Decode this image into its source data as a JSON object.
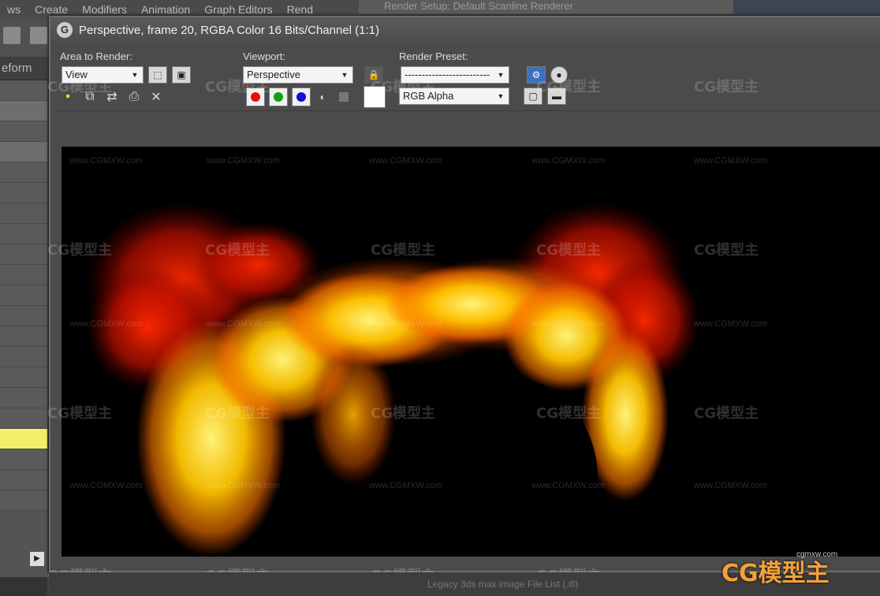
{
  "background": {
    "menu": [
      "ws",
      "Create",
      "Modifiers",
      "Animation",
      "Graph Editors",
      "Rend"
    ],
    "left_tab": "eform",
    "render_setup_title": "Render Setup: Default Scanline Renderer",
    "bottom_status": "Legacy 3ds max image File List (.ifl)"
  },
  "window": {
    "title": "Perspective, frame 20, RGBA Color 16 Bits/Channel (1:1)"
  },
  "controls": {
    "area_label": "Area to Render:",
    "area_value": "View",
    "viewport_label": "Viewport:",
    "viewport_value": "Perspective",
    "preset_label": "Render Preset:",
    "preset_value": "-------------------------",
    "channel_value": "RGB Alpha"
  },
  "channel_colors": {
    "red": "#e01010",
    "green": "#10a010",
    "blue": "#1010d0"
  },
  "watermarks": {
    "logo": "CG模型主",
    "url": "www.CGMXW.com",
    "corner_url": "cgmxw.com"
  },
  "icons": [
    "save-icon",
    "copy-icon",
    "clone-icon",
    "print-icon",
    "clear-icon",
    "lock-icon",
    "render-icon",
    "teapot-icon"
  ]
}
